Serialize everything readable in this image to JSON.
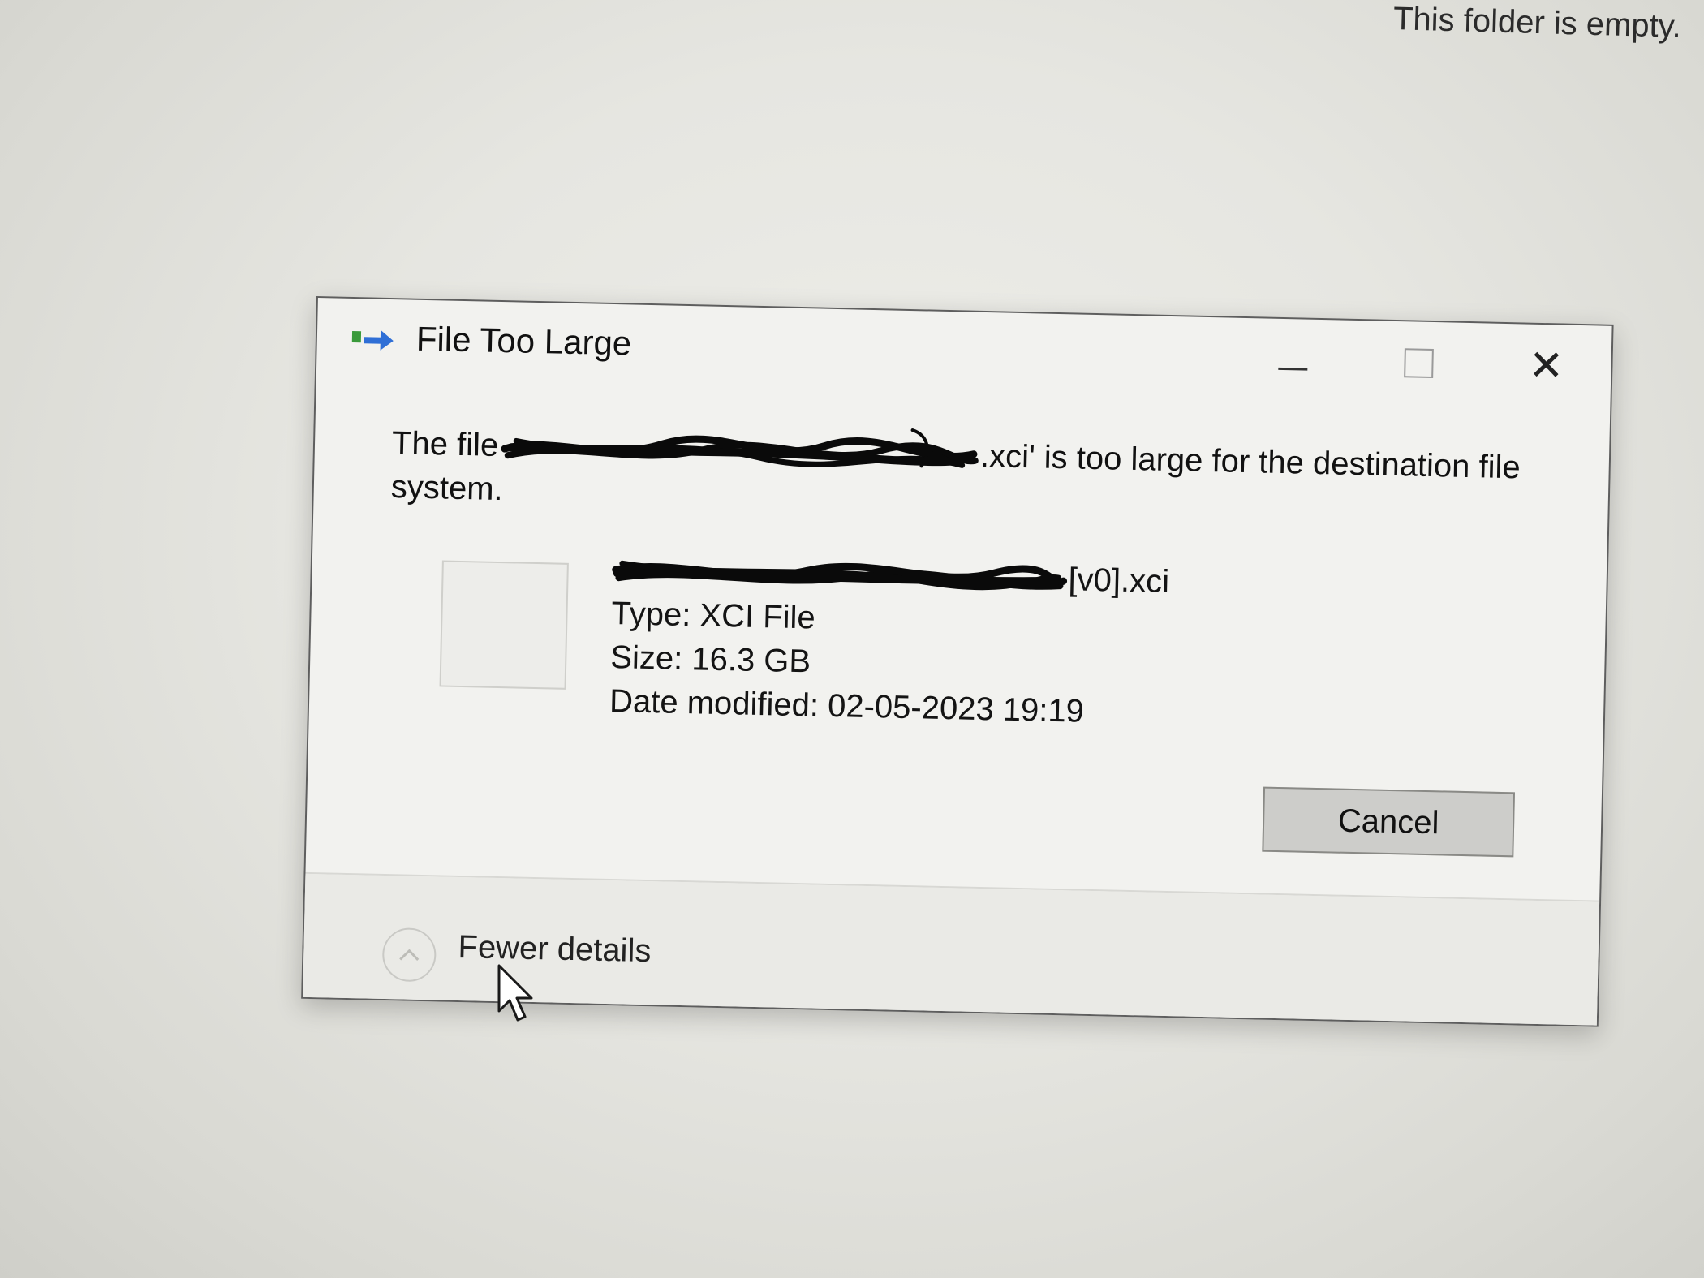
{
  "explorer": {
    "empty_message": "This folder is empty."
  },
  "dialog": {
    "title": "File Too Large",
    "title_icon": "file-move-icon",
    "controls": {
      "minimize_icon": "minimize-icon",
      "maximize_icon": "maximize-icon",
      "close_icon": "close-icon"
    },
    "message_prefix": "The file",
    "message_suffix": ".xci' is too large for the destination file system.",
    "file": {
      "name_visible_suffix": "[v0].xci",
      "type": "Type: XCI File",
      "size": "Size: 16.3 GB",
      "date_modified": "Date modified: 02-05-2023 19:19"
    },
    "cancel_label": "Cancel",
    "details_toggle_label": "Fewer details",
    "details_toggle_icon": "chevron-up-icon"
  },
  "colors": {
    "background": "#e6e6e1",
    "dialog_background": "#f2f2ef",
    "button_background": "#cdcdca",
    "icon_green": "#3a9a3a",
    "icon_blue": "#2f6fd6",
    "scribble_ink": "#0a0a0a"
  }
}
